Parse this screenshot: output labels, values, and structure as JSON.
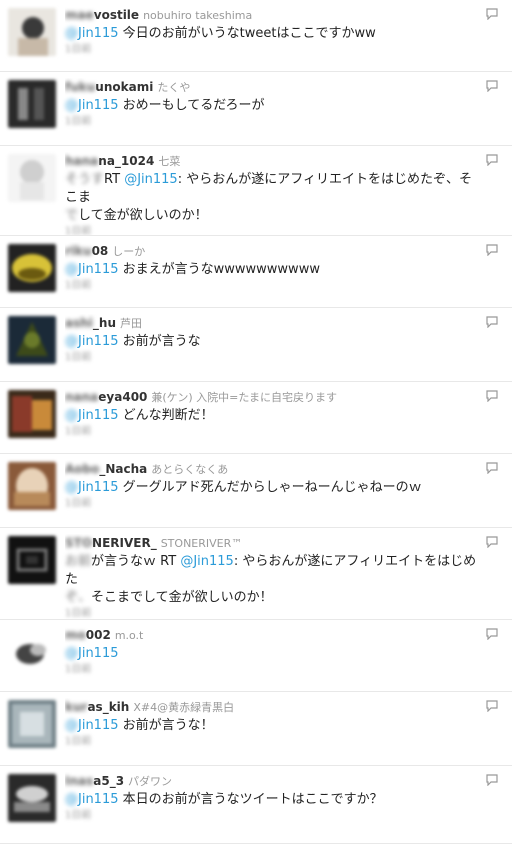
{
  "tweets": [
    {
      "screen_blur": "mae",
      "screen": "vostile",
      "full_name": "nobuhiro takeshima",
      "mention_blur": "@",
      "mention": "Jin115",
      "text": " 今日のお前がいうなtweetはここですかww",
      "time": "1日前",
      "avatar_colors": [
        "#e9e6e0",
        "#3a3a3a",
        "#c7b9a8"
      ]
    },
    {
      "screen_blur": "fuku",
      "screen": "unokami",
      "full_name": "たくや",
      "mention_blur": "@",
      "mention": "Jin115",
      "text": " おめーもしてるだろーが",
      "time": "1日前",
      "avatar_colors": [
        "#2a2a2a",
        "#555",
        "#888"
      ]
    },
    {
      "screen_blur": "hana",
      "screen": "na_1024",
      "full_name": "七菜",
      "text_blur": "そうす",
      "text_pre": "RT ",
      "mention": "@Jin115",
      "text": ": やらおんが遂にアフィリエイトをはじめたぞ、そこま",
      "text2_blur": "で",
      "text2": "して金が欲しいのか！",
      "time": "1日前",
      "avatar_colors": [
        "#f4f4f4",
        "#cfcfcf",
        "#e6e6e6"
      ]
    },
    {
      "screen_blur": "riku",
      "screen": "08",
      "full_name": "しーか",
      "mention_blur": "@",
      "mention": "Jin115",
      "text": " おまえが言うなwwwwwwwwww",
      "time": "1日前",
      "avatar_colors": [
        "#d8c238",
        "#6b5a10",
        "#222"
      ]
    },
    {
      "screen_blur": "ashi",
      "screen": "_hu",
      "full_name": "芦田",
      "mention_blur": "@",
      "mention": "Jin115",
      "text": " お前が言うな",
      "time": "1日前",
      "avatar_colors": [
        "#3d4a1a",
        "#1b2a38",
        "#6a7a2a"
      ]
    },
    {
      "screen_blur": "nana",
      "screen": "eya400",
      "full_name": "兼(ケン) 入院中=たまに自宅戻ります",
      "mention_blur": "@",
      "mention": "Jin115",
      "text": " どんな判断だ！",
      "time": "1日前",
      "avatar_colors": [
        "#8a3a2a",
        "#c98a3a",
        "#3a2a1a"
      ]
    },
    {
      "screen_blur": "Aobo",
      "screen": "_Nacha",
      "full_name": "あとらくなくあ",
      "mention_blur": "@",
      "mention": "Jin115",
      "text": " グーグルアド死んだからしゃーねーんじゃねーのｗ",
      "time": "1日前",
      "avatar_colors": [
        "#b88a5a",
        "#e8d2b8",
        "#8a5a3a"
      ]
    },
    {
      "screen_blur": "STO",
      "screen": "NERIVER_",
      "full_name": "STONERIVER™",
      "text_blur": "お前",
      "text_pre": "が言うなｗ RT ",
      "mention": "@Jin115",
      "text": ": やらおんが遂にアフィリエイトをはじめた",
      "text2_blur": "ぞ、",
      "text2": "そこまでして金が欲しいのか！",
      "time": "1日前",
      "avatar_colors": [
        "#111",
        "#333",
        "#777"
      ]
    },
    {
      "screen_blur": "mo",
      "screen": "002",
      "full_name": "m.o.t",
      "mention_blur": "@",
      "mention": "Jin115",
      "text": "",
      "time": "1日前",
      "avatar_colors": [
        "#ffffff",
        "#444",
        "#bbb"
      ]
    },
    {
      "screen_blur": "kur",
      "screen": "as_kih",
      "full_name": "X#4@黄赤緑青黒白",
      "mention_blur": "@",
      "mention": "Jin115",
      "text": " お前が言うな！",
      "time": "1日前",
      "avatar_colors": [
        "#a9b6bb",
        "#d7dfe2",
        "#6f7f86"
      ]
    },
    {
      "screen_blur": "Inas",
      "screen": "a5_3",
      "full_name": "パダワン",
      "mention_blur": "@",
      "mention": "Jin115",
      "text": " 本日のお前が言うなツイートはここですか？",
      "time": "1日前",
      "avatar_colors": [
        "#2a2a2a",
        "#8a8a8a",
        "#d0d0d0"
      ]
    }
  ]
}
